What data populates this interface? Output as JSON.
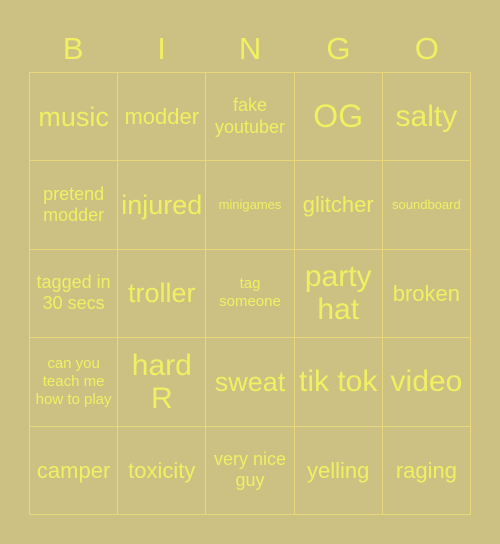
{
  "card": {
    "title": "BINGO",
    "background_color": "#ccc183",
    "text_color": "#f2ef63",
    "grid_line_color": "#e8d879"
  },
  "header": {
    "letters": [
      {
        "label": "B"
      },
      {
        "label": "I"
      },
      {
        "label": "N"
      },
      {
        "label": "G"
      },
      {
        "label": "O"
      }
    ]
  },
  "grid": {
    "rows": 5,
    "columns": 5,
    "cells": [
      {
        "label": "music",
        "size": "xl"
      },
      {
        "label": "modder",
        "size": "lg"
      },
      {
        "label": "fake youtuber",
        "size": "md"
      },
      {
        "label": "OG",
        "size": "huge"
      },
      {
        "label": "salty",
        "size": "xxl"
      },
      {
        "label": "pretend modder",
        "size": "md"
      },
      {
        "label": "injured",
        "size": "xl"
      },
      {
        "label": "minigames",
        "size": "xs"
      },
      {
        "label": "glitcher",
        "size": "lg"
      },
      {
        "label": "soundboard",
        "size": "xs"
      },
      {
        "label": "tagged in 30 secs",
        "size": "md"
      },
      {
        "label": "troller",
        "size": "xl"
      },
      {
        "label": "tag someone",
        "size": "sm"
      },
      {
        "label": "party hat",
        "size": "xxl"
      },
      {
        "label": "broken",
        "size": "lg"
      },
      {
        "label": "can you teach me how to play",
        "size": "sm"
      },
      {
        "label": "hard R",
        "size": "xxl"
      },
      {
        "label": "sweat",
        "size": "xl"
      },
      {
        "label": "tik tok",
        "size": "xxl"
      },
      {
        "label": "video",
        "size": "xxl"
      },
      {
        "label": "camper",
        "size": "lg"
      },
      {
        "label": "toxicity",
        "size": "lg"
      },
      {
        "label": "very nice guy",
        "size": "md"
      },
      {
        "label": "yelling",
        "size": "lg"
      },
      {
        "label": "raging",
        "size": "lg"
      }
    ]
  }
}
